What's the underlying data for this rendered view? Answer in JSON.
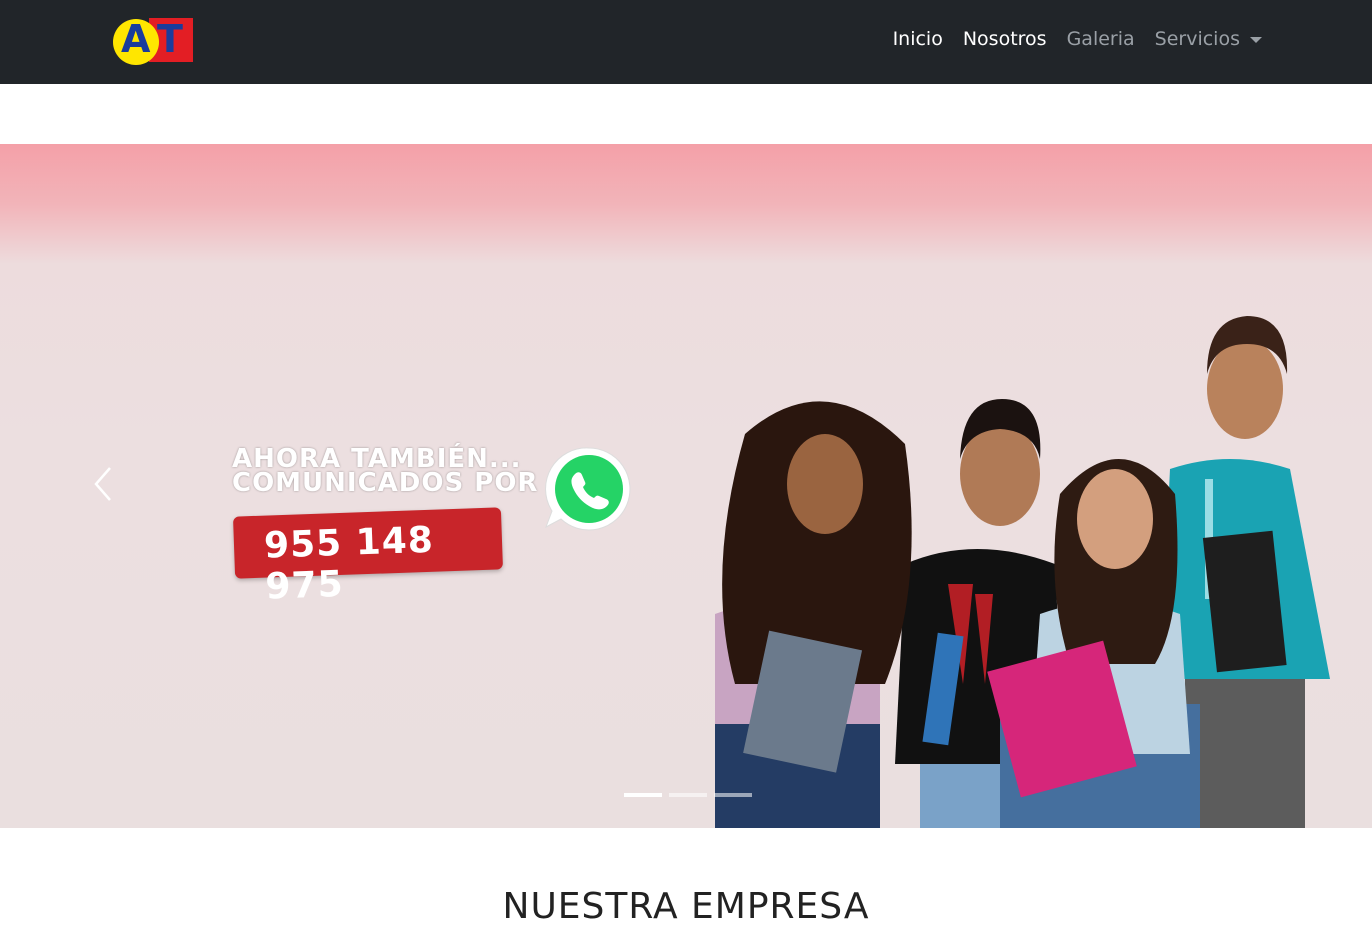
{
  "brand": {
    "logo_text_a": "A",
    "logo_text_t": "T"
  },
  "nav": {
    "items": [
      {
        "label": "Inicio",
        "state": "active"
      },
      {
        "label": "Nosotros",
        "state": "active"
      },
      {
        "label": "Galeria",
        "state": "muted"
      },
      {
        "label": "Servicios",
        "state": "muted",
        "dropdown": true
      }
    ]
  },
  "hero": {
    "line1": "AHORA TAMBIÉN...",
    "line2": "COMUNICADOS POR",
    "phone": "955 148 975",
    "icon": "whatsapp-icon",
    "slides_count": 3,
    "active_slide": 1
  },
  "section": {
    "title": "NUESTRA EMPRESA"
  },
  "colors": {
    "navbar": "#212529",
    "accent_red": "#c8252a",
    "whatsapp_green": "#25d366"
  }
}
